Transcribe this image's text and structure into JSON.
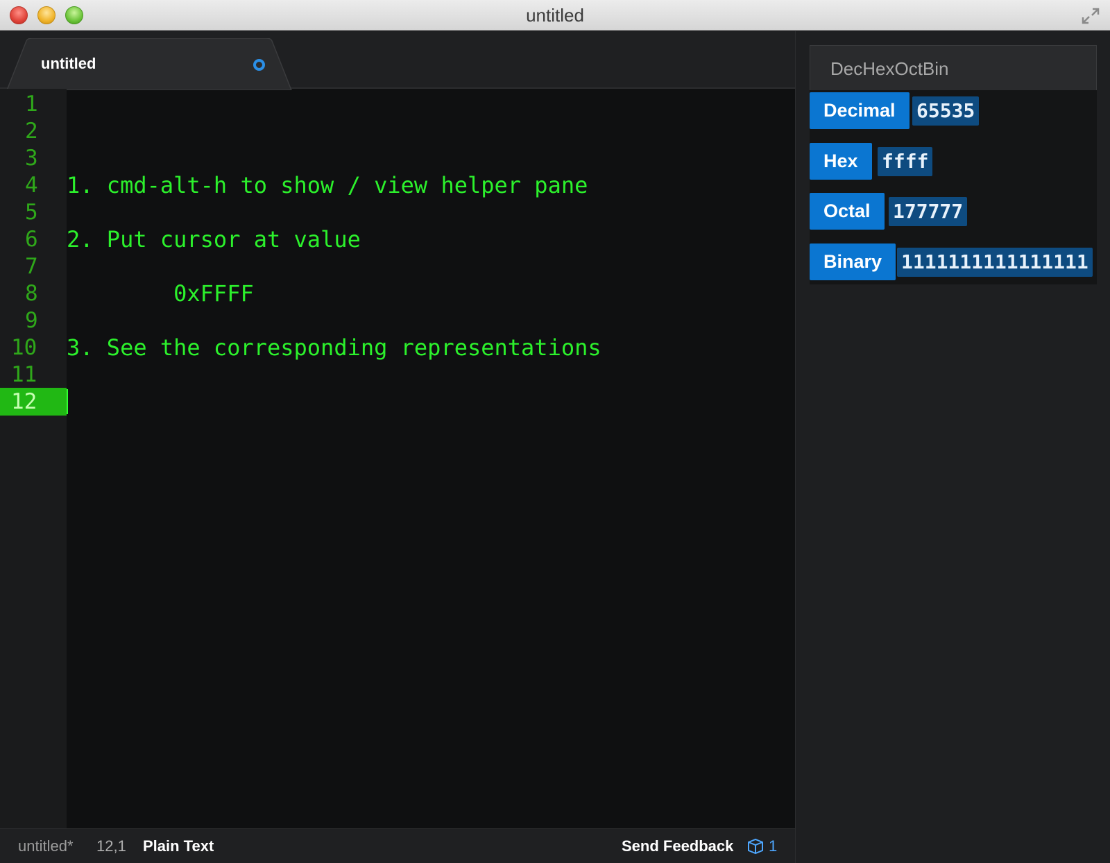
{
  "window": {
    "title": "untitled"
  },
  "tab": {
    "label": "untitled",
    "dirty_indicator": "modified-dot"
  },
  "editor": {
    "line_numbers": [
      "1",
      "2",
      "3",
      "4",
      "5",
      "6",
      "7",
      "8",
      "9",
      "10",
      "11",
      "12"
    ],
    "active_line": 12,
    "lines": [
      "",
      "",
      "",
      "1. cmd-alt-h to show / view helper pane",
      "",
      "2. Put cursor at value",
      "",
      "        0xFFFF",
      "",
      "3. See the corresponding representations",
      "",
      ""
    ],
    "text_color": "#2cf12c"
  },
  "statusbar": {
    "file": "untitled*",
    "cursor": "12,1",
    "grammar": "Plain Text",
    "feedback": "Send Feedback",
    "package_count": "1"
  },
  "helper_pane": {
    "title": "DecHexOctBin",
    "rows": [
      {
        "label": "Decimal",
        "value": "65535"
      },
      {
        "label": "Hex",
        "value": "ffff"
      },
      {
        "label": "Octal",
        "value": "177777"
      },
      {
        "label": "Binary",
        "value": "1111111111111111"
      }
    ],
    "accent": "#0b76d1"
  }
}
